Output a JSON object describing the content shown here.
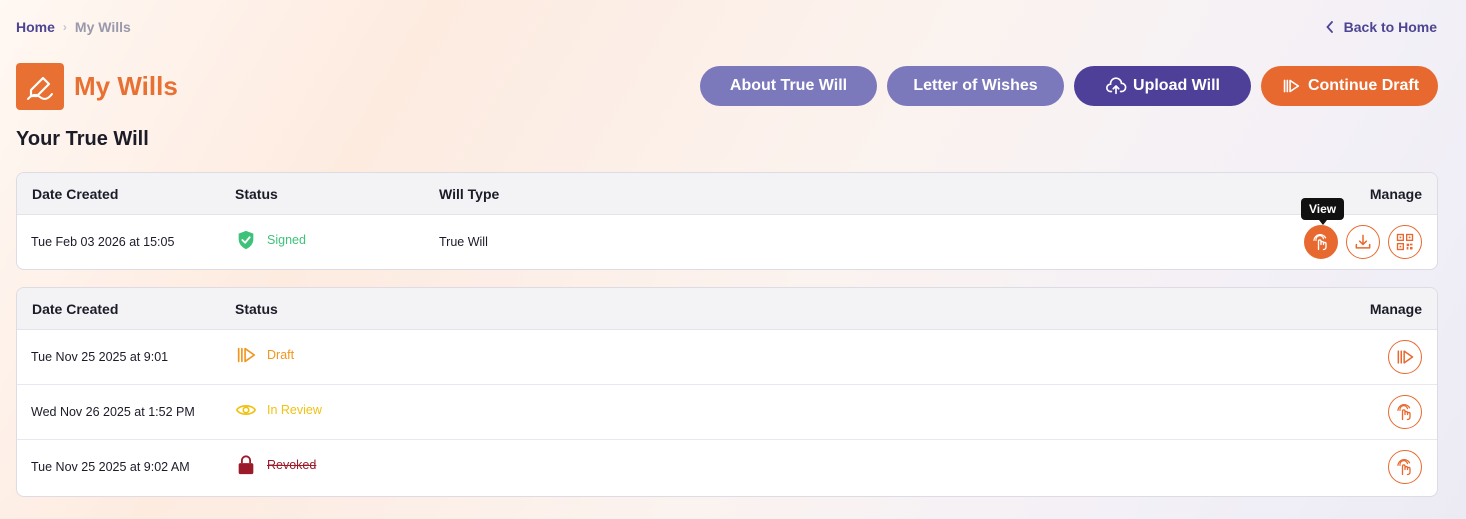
{
  "breadcrumb": {
    "home": "Home",
    "separator": "›",
    "current": "My Wills"
  },
  "back_link": {
    "label": "Back to Home"
  },
  "page": {
    "title": "My Wills",
    "accent": "#e87033"
  },
  "actions": {
    "about": "About True Will",
    "letter": "Letter of Wishes",
    "upload": "Upload Will",
    "draft": "Continue Draft"
  },
  "section": {
    "title": "Your True Will"
  },
  "true_will_table": {
    "columns": {
      "date": "Date Created",
      "status": "Status",
      "type": "Will Type",
      "manage": "Manage"
    },
    "rows": [
      {
        "date": "Tue Feb 03 2026 at 15:05",
        "status": "Signed",
        "status_color": "#3ec27a",
        "type": "True Will"
      }
    ],
    "tooltip": "View"
  },
  "history_table": {
    "columns": {
      "date": "Date Created",
      "status": "Status",
      "manage": "Manage"
    },
    "rows": [
      {
        "date": "Tue Nov 25 2025 at 9:01",
        "status": "Draft",
        "status_color": "#f0961e"
      },
      {
        "date": "Wed Nov 26 2025 at 1:52 PM",
        "status": "In Review",
        "status_color": "#f0c214"
      },
      {
        "date": "Tue Nov 25 2025 at 9:02 AM",
        "status": "Revoked",
        "status_color": "#9c1b2b"
      }
    ]
  }
}
